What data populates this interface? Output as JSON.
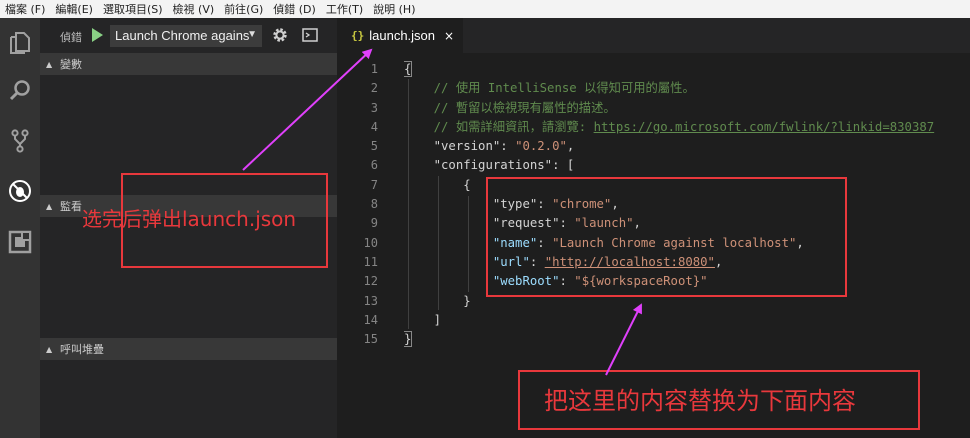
{
  "menu": [
    "檔案 (F)",
    "編輯(E)",
    "選取項目(S)",
    "檢視 (V)",
    "前往(G)",
    "偵錯 (D)",
    "工作(T)",
    "說明 (H)"
  ],
  "activity_icons": [
    "files-icon",
    "search-icon",
    "source-control-icon",
    "debug-icon",
    "extensions-icon"
  ],
  "sidebar": {
    "title": "偵錯",
    "config_value": "Launch Chrome agains",
    "sections": [
      "變數",
      "監看",
      "呼叫堆疊"
    ]
  },
  "editor": {
    "tab": {
      "icon": "{}",
      "label": "launch.json",
      "close": "×"
    },
    "line_numbers": [
      "1",
      "2",
      "3",
      "4",
      "5",
      "6",
      "7",
      "8",
      "9",
      "10",
      "11",
      "12",
      "13",
      "14",
      "15"
    ]
  },
  "annotations": {
    "left_note": "选完后弹出launch.json",
    "bottom_note": "把这里的内容替换为下面内容",
    "color": "#e8383c",
    "arrow_color": "#e040fb"
  },
  "colors": {
    "activity_bar": "#333333",
    "sidebar": "#252526",
    "editor": "#1e1e1e",
    "comment": "#608b4e",
    "string": "#ce9178",
    "key": "#9cdcfe"
  }
}
